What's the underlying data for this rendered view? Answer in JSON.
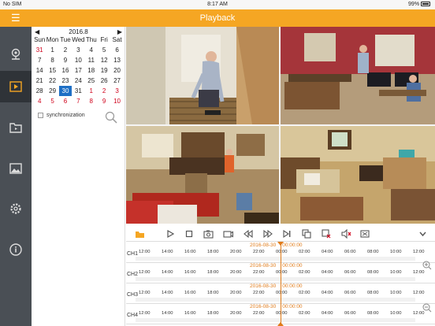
{
  "status": {
    "carrier": "No SIM",
    "time": "8:17 AM",
    "battery": "99%"
  },
  "header": {
    "title": "Playback"
  },
  "sidebar": {
    "items": [
      {
        "icon": "camera-icon"
      },
      {
        "icon": "playback-icon"
      },
      {
        "icon": "recordings-folder-icon"
      },
      {
        "icon": "pictures-icon"
      },
      {
        "icon": "settings-icon"
      },
      {
        "icon": "info-icon"
      }
    ]
  },
  "calendar": {
    "month": "2016.8",
    "weekdays": [
      "Sun",
      "Mon",
      "Tue",
      "Wed",
      "Thu",
      "Fri",
      "Sat"
    ],
    "weeks": [
      [
        "31",
        "1",
        "2",
        "3",
        "4",
        "5",
        "6"
      ],
      [
        "7",
        "8",
        "9",
        "10",
        "11",
        "12",
        "13"
      ],
      [
        "14",
        "15",
        "16",
        "17",
        "18",
        "19",
        "20"
      ],
      [
        "21",
        "22",
        "23",
        "24",
        "25",
        "26",
        "27"
      ],
      [
        "28",
        "29",
        "30",
        "31",
        "1",
        "2",
        "3"
      ],
      [
        "4",
        "5",
        "6",
        "7",
        "8",
        "9",
        "10"
      ]
    ],
    "selected": "30",
    "sync_label": "synchronization"
  },
  "timeline": {
    "date": "2016-08-30",
    "time": "00:00:00",
    "channels": [
      "CH1",
      "CH2",
      "CH3",
      "CH4"
    ],
    "ticks": [
      "12:00",
      "14:00",
      "16:00",
      "18:00",
      "20:00",
      "22:00",
      "00:00",
      "02:00",
      "04:00",
      "06:00",
      "08:00",
      "10:00",
      "12:00"
    ]
  },
  "colors": {
    "accent": "#f5a623",
    "selected": "#1e6fc5",
    "cursor": "#e07b19"
  }
}
